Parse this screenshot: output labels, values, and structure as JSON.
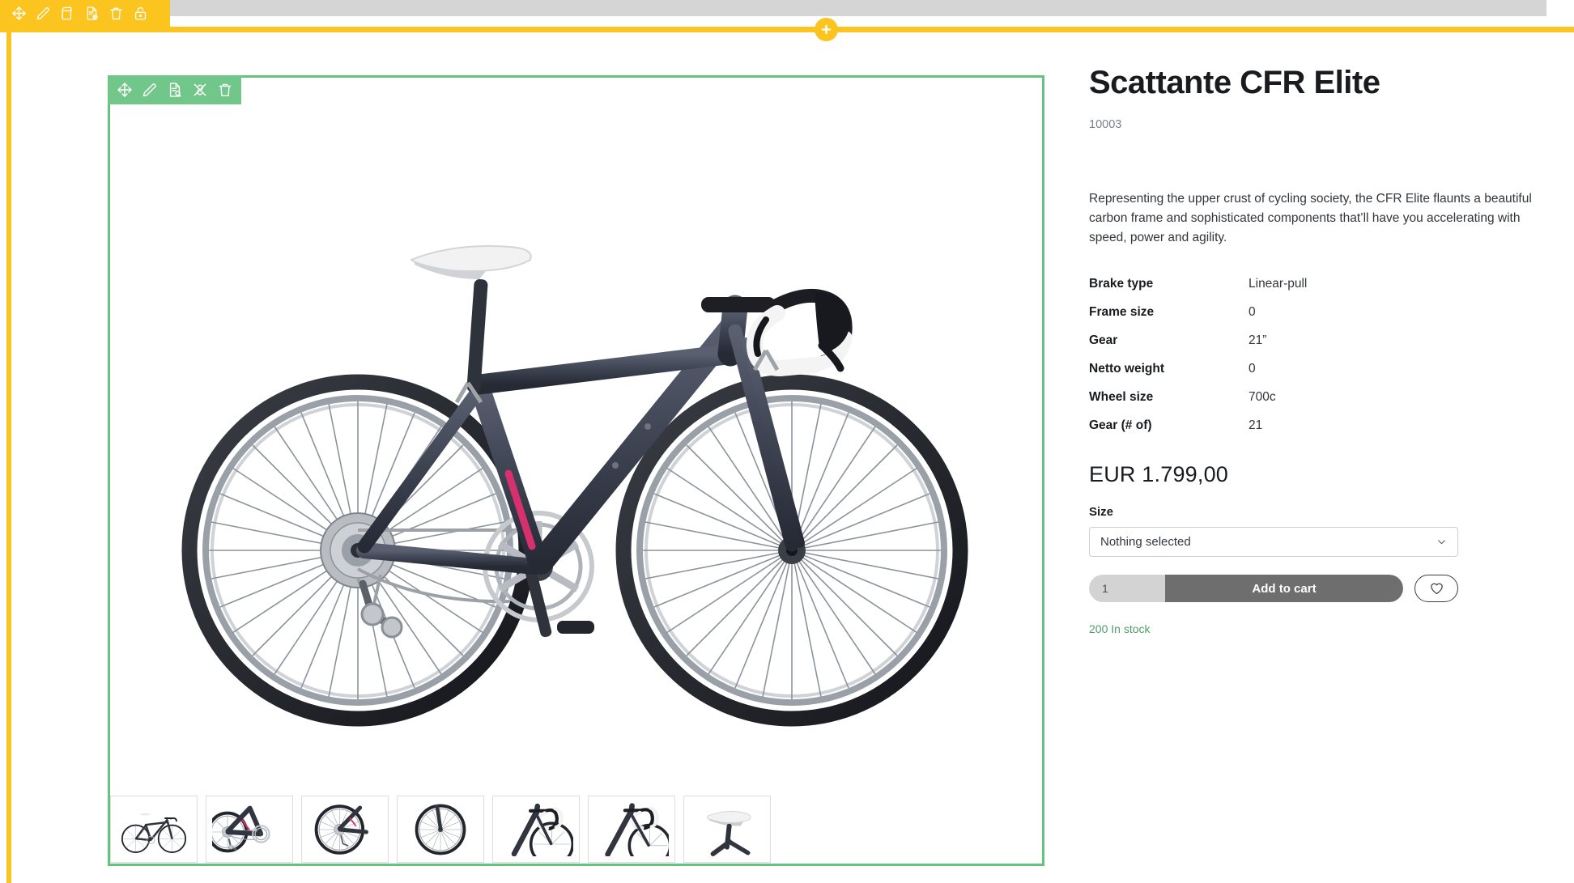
{
  "editor": {
    "top_toolbar": [
      {
        "name": "move-icon",
        "label": "Move"
      },
      {
        "name": "edit-pencil-icon",
        "label": "Edit"
      },
      {
        "name": "duplicate-icon",
        "label": "Duplicate"
      },
      {
        "name": "document-add-icon",
        "label": "Add document"
      },
      {
        "name": "trash-icon",
        "label": "Delete"
      },
      {
        "name": "lock-icon",
        "label": "Lock"
      }
    ],
    "block_toolbar": [
      {
        "name": "move-icon",
        "label": "Move block"
      },
      {
        "name": "edit-pencil-icon",
        "label": "Edit block"
      },
      {
        "name": "document-search-icon",
        "label": "Document settings"
      },
      {
        "name": "unlink-icon",
        "label": "Unlink"
      },
      {
        "name": "trash-icon",
        "label": "Delete block"
      }
    ],
    "add_button_label": "+",
    "accent_yellow": "#fbc41f",
    "selection_green": "#65c37f"
  },
  "product": {
    "title": "Scattante CFR Elite",
    "sku": "10003",
    "description": "Representing the upper crust of cycling society, the CFR Elite flaunts a beautiful carbon frame and sophisticated components that’ll have you accelerating with speed, power and agility.",
    "specs": [
      {
        "key": "Brake type",
        "value": "Linear-pull"
      },
      {
        "key": "Frame size",
        "value": "0"
      },
      {
        "key": "Gear",
        "value": "21”"
      },
      {
        "key": "Netto weight",
        "value": "0"
      },
      {
        "key": "Wheel size",
        "value": "700c"
      },
      {
        "key": "Gear (# of)",
        "value": "21"
      }
    ],
    "price": "EUR 1.799,00",
    "size_label": "Size",
    "size_selected": "Nothing selected",
    "quantity": "1",
    "add_to_cart_label": "Add to cart",
    "wishlist_icon": "heart-icon",
    "stock": "200 In stock",
    "stock_color": "#4f9d69",
    "thumbnails": [
      {
        "name": "thumbnail-full-bike",
        "view": "full"
      },
      {
        "name": "thumbnail-drivetrain",
        "view": "drivetrain"
      },
      {
        "name": "thumbnail-rear-wheel",
        "view": "rearwheel"
      },
      {
        "name": "thumbnail-front-wheel",
        "view": "frontwheel"
      },
      {
        "name": "thumbnail-handlebar-a",
        "view": "bar"
      },
      {
        "name": "thumbnail-handlebar-b",
        "view": "bar"
      },
      {
        "name": "thumbnail-saddle",
        "view": "saddle"
      }
    ]
  }
}
